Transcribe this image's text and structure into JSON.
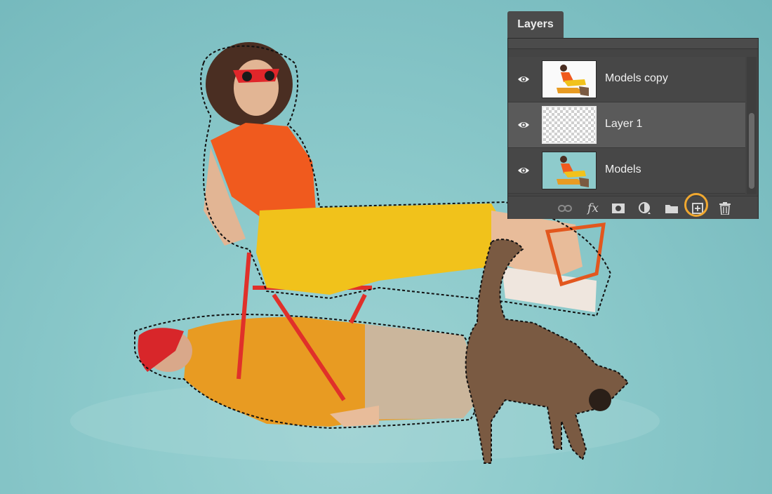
{
  "panel": {
    "tab_label": "Layers",
    "layers": [
      {
        "name": "Models copy",
        "visible": true,
        "thumbnail": "models-photo-transparent"
      },
      {
        "name": "Layer 1",
        "visible": true,
        "selected": true,
        "thumbnail": "empty-transparent"
      },
      {
        "name": "Models",
        "visible": true,
        "thumbnail": "models-photo"
      }
    ],
    "footer_buttons": [
      {
        "name": "link-layers",
        "icon": "link-icon"
      },
      {
        "name": "add-layer-style",
        "label": "fx"
      },
      {
        "name": "add-mask",
        "icon": "mask-icon"
      },
      {
        "name": "new-adjustment-layer",
        "icon": "adjustment-icon"
      },
      {
        "name": "new-group",
        "icon": "folder-icon"
      },
      {
        "name": "new-layer",
        "icon": "new-layer-icon",
        "highlighted": true
      },
      {
        "name": "delete-layer",
        "icon": "trash-icon"
      }
    ]
  },
  "colors": {
    "background": "#8ecbcc",
    "highlight": "#f0a830",
    "panel": "#444444"
  }
}
